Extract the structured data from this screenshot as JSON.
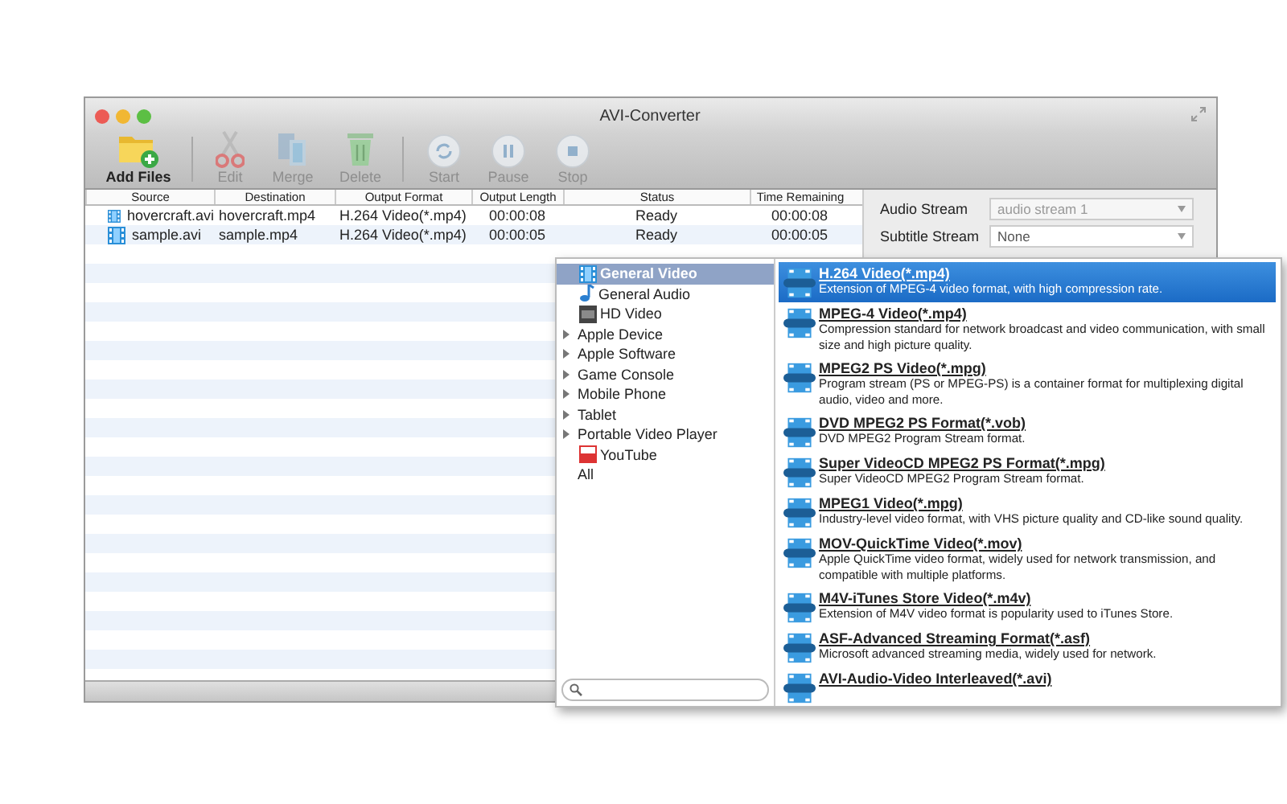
{
  "window": {
    "title": "AVI-Converter"
  },
  "toolbar": [
    {
      "kind": "add",
      "label": "Add Files",
      "disabled": false
    },
    {
      "kind": "edit",
      "label": "Edit",
      "disabled": true
    },
    {
      "kind": "merge",
      "label": "Merge",
      "disabled": true
    },
    {
      "kind": "delete",
      "label": "Delete",
      "disabled": true
    },
    {
      "kind": "start",
      "label": "Start",
      "disabled": true
    },
    {
      "kind": "pause",
      "label": "Pause",
      "disabled": true
    },
    {
      "kind": "stop",
      "label": "Stop",
      "disabled": true
    }
  ],
  "table": {
    "columns": [
      "Source",
      "Destination",
      "Output Format",
      "Output Length",
      "Status",
      "Time Remaining"
    ],
    "rows": [
      [
        "hovercraft.avi",
        "hovercraft.mp4",
        "H.264 Video(*.mp4)",
        "00:00:08",
        "Ready",
        "00:00:08"
      ],
      [
        "sample.avi",
        "sample.mp4",
        "H.264 Video(*.mp4)",
        "00:00:05",
        "Ready",
        "00:00:05"
      ]
    ]
  },
  "streams": [
    {
      "label": "Audio Stream",
      "value": "audio stream 1",
      "disabled": true
    },
    {
      "label": "Subtitle Stream",
      "value": "None",
      "disabled": false
    }
  ],
  "format_menu": {
    "categories": [
      {
        "label": "General Video",
        "kind": "video",
        "selected": true
      },
      {
        "label": "General Audio",
        "kind": "audio",
        "selected": false
      },
      {
        "label": "HD Video",
        "kind": "hd",
        "selected": false
      },
      {
        "label": "Apple Device",
        "kind": "group",
        "expanded": false,
        "selected": false
      },
      {
        "label": "Apple Software",
        "kind": "group",
        "expanded": false,
        "selected": false
      },
      {
        "label": "Game Console",
        "kind": "group",
        "expanded": false,
        "selected": false
      },
      {
        "label": "Mobile Phone",
        "kind": "group",
        "expanded": false,
        "selected": false
      },
      {
        "label": "Tablet",
        "kind": "group",
        "expanded": false,
        "selected": false
      },
      {
        "label": "Portable Video Player",
        "kind": "group",
        "expanded": false,
        "selected": false
      },
      {
        "label": "YouTube",
        "kind": "youtube",
        "selected": false
      },
      {
        "label": "All",
        "kind": "plain",
        "selected": false
      }
    ],
    "formats": [
      {
        "title": "H.264 Video(*.mp4)",
        "description": "Extension of MPEG-4 video format, with high compression rate.",
        "selected": true
      },
      {
        "title": "MPEG-4 Video(*.mp4)",
        "description": "Compression standard for network broadcast and video communication, with small size and high picture quality.",
        "selected": false
      },
      {
        "title": "MPEG2 PS Video(*.mpg)",
        "description": "Program stream (PS or MPEG-PS) is a container format for multiplexing digital audio, video and more.",
        "selected": false
      },
      {
        "title": "DVD MPEG2 PS Format(*.vob)",
        "description": "DVD MPEG2 Program Stream format.",
        "selected": false
      },
      {
        "title": "Super VideoCD MPEG2 PS Format(*.mpg)",
        "description": "Super VideoCD MPEG2 Program Stream format.",
        "selected": false
      },
      {
        "title": "MPEG1 Video(*.mpg)",
        "description": "Industry-level video format, with VHS picture quality and CD-like sound quality.",
        "selected": false
      },
      {
        "title": "MOV-QuickTime Video(*.mov)",
        "description": "Apple QuickTime video format, widely used for network transmission, and compatible with multiple platforms.",
        "selected": false
      },
      {
        "title": "M4V-iTunes Store Video(*.m4v)",
        "description": "Extension of M4V video format is popularity used to iTunes Store.",
        "selected": false
      },
      {
        "title": "ASF-Advanced Streaming Format(*.asf)",
        "description": "Microsoft advanced streaming media, widely used for network.",
        "selected": false
      },
      {
        "title": "AVI-Audio-Video Interleaved(*.avi)",
        "selected": false
      }
    ]
  }
}
